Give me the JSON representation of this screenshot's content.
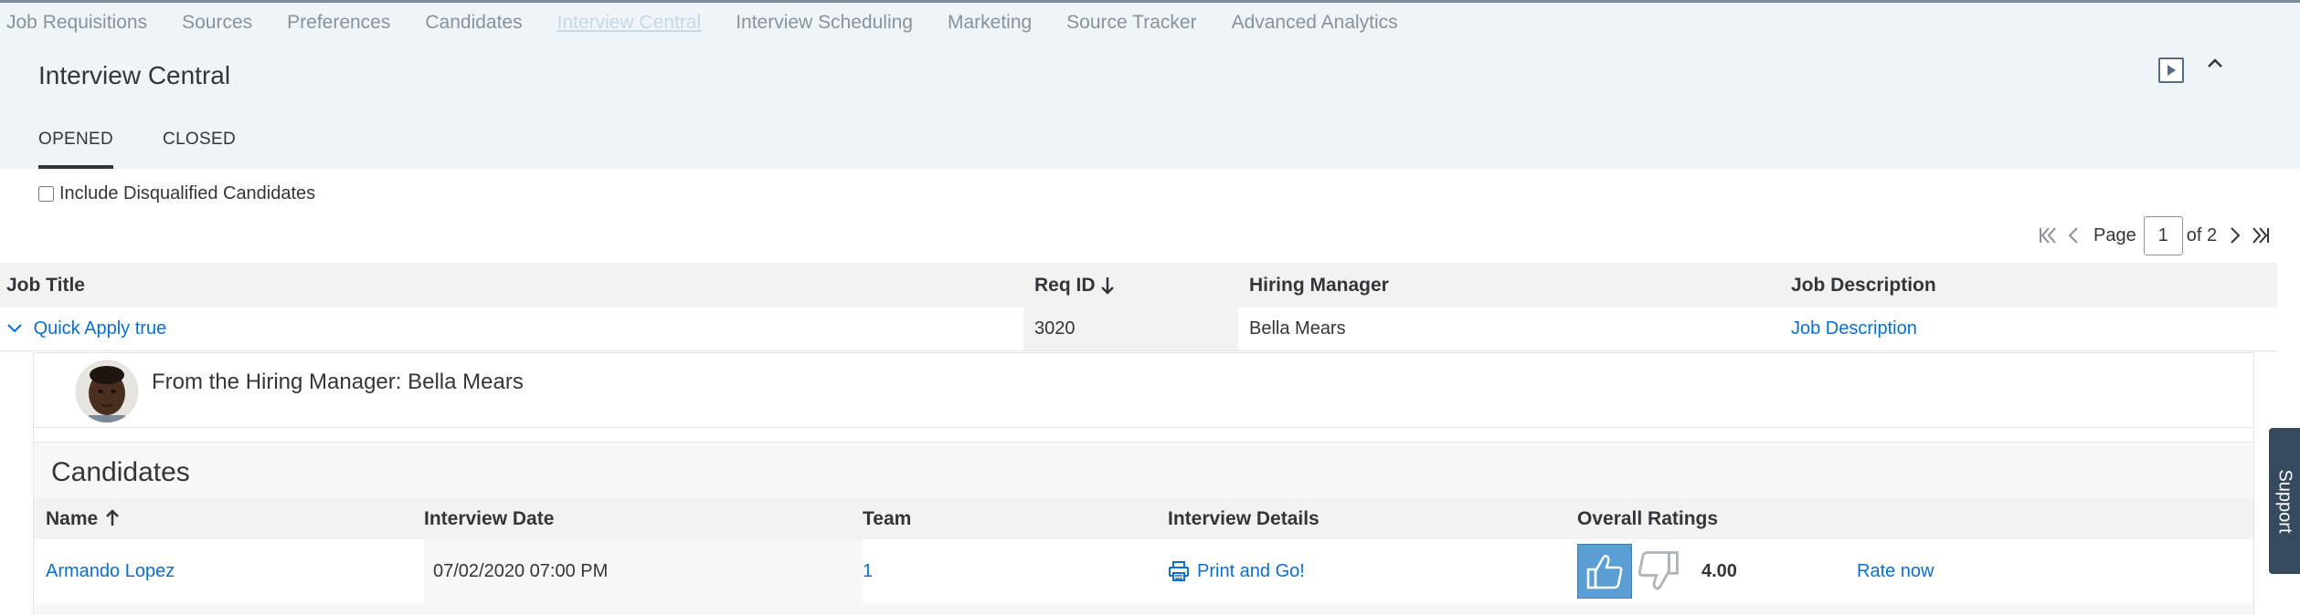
{
  "nav": {
    "items": [
      {
        "label": "Job Requisitions"
      },
      {
        "label": "Sources"
      },
      {
        "label": "Preferences"
      },
      {
        "label": "Candidates"
      },
      {
        "label": "Interview Central"
      },
      {
        "label": "Interview Scheduling"
      },
      {
        "label": "Marketing"
      },
      {
        "label": "Source Tracker"
      },
      {
        "label": "Advanced Analytics"
      }
    ]
  },
  "header": {
    "title": "Interview Central",
    "play_icon": "play-icon",
    "collapse_icon": "chevron-up-icon"
  },
  "tabs": [
    {
      "label": "OPENED",
      "active": true
    },
    {
      "label": "CLOSED",
      "active": false
    }
  ],
  "filter": {
    "include_disqualified_label": "Include Disqualified Candidates",
    "checked": false
  },
  "pager": {
    "page_label": "Page",
    "current_page": "1",
    "of_label": "of 2"
  },
  "requisitions": {
    "columns": {
      "job_title": "Job Title",
      "req_id": "Req ID",
      "hiring_manager": "Hiring Manager",
      "job_description": "Job Description"
    },
    "rows": [
      {
        "job_title": "Quick Apply true",
        "req_id": "3020",
        "hiring_manager": "Bella Mears",
        "job_description": "Job Description"
      }
    ]
  },
  "detail": {
    "hiring_manager_text": "From the Hiring Manager: Bella Mears",
    "candidates_title": "Candidates",
    "columns": {
      "name": "Name",
      "interview_date": "Interview Date",
      "team": "Team",
      "interview_details": "Interview Details",
      "overall_ratings": "Overall Ratings"
    },
    "candidates": [
      {
        "name": "Armando Lopez",
        "interview_date": "07/02/2020 07:00 PM",
        "team": "1",
        "details_link": "Print and Go!",
        "rating": "4.00",
        "rate_link": "Rate now"
      }
    ]
  },
  "support": {
    "label": "Support"
  },
  "colors": {
    "link": "#0a6ed1",
    "header_bg": "#eff4f9",
    "support_bg": "#354a5f",
    "thumb_up": "#5a9fd4"
  }
}
